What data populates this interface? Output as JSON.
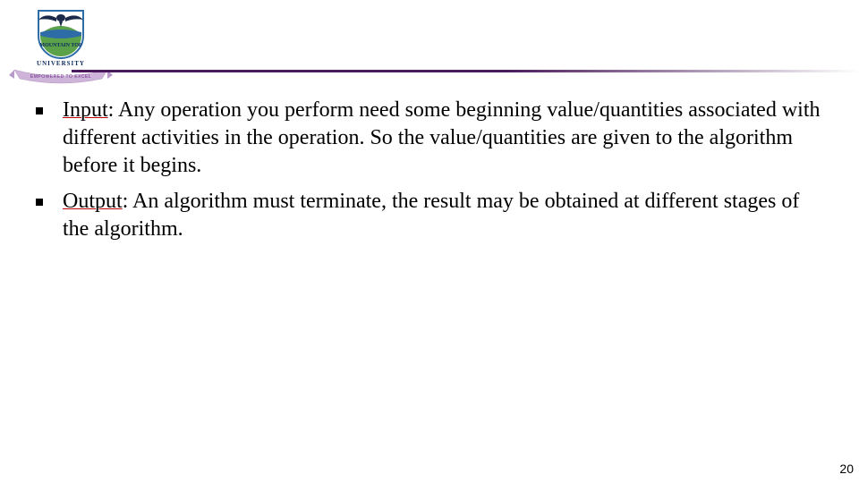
{
  "logo": {
    "name": "university-logo",
    "top_text": "MOUNTAIN TOP",
    "bottom_text": "UNIVERSITY",
    "banner_text": "EMPOWERED TO EXCEL",
    "colors": {
      "crest_blue": "#2e6ca8",
      "crest_green": "#5aa14a",
      "eagle": "#1b2a4a",
      "banner": "#cdb4d8",
      "banner_text": "#6b2b8a"
    }
  },
  "divider_color": "#4a1a5c",
  "bullets": [
    {
      "term": "Input",
      "rest": ": Any operation you perform need some beginning value/quantities associated with different activities in the operation. So the value/quantities are given to the algorithm before it begins."
    },
    {
      "term": "Output",
      "rest": ": An algorithm must terminate, the result may be obtained at different stages of the algorithm."
    }
  ],
  "page_number": "20"
}
